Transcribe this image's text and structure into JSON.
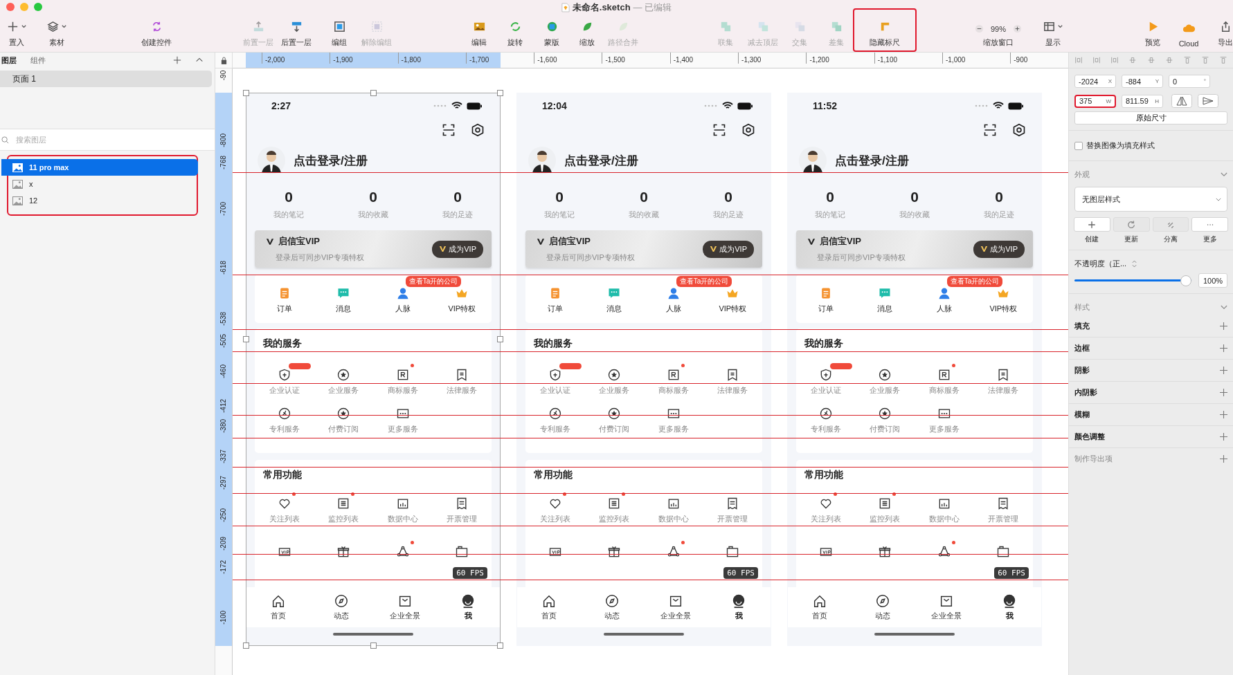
{
  "window": {
    "title": "未命名.sketch",
    "status": "— 已编辑"
  },
  "toolbar": [
    {
      "kind": "button",
      "label": "置入",
      "dropdown": true,
      "disabled": false,
      "highlighted": false
    },
    {
      "kind": "button",
      "label": "素材",
      "dropdown": true,
      "disabled": false,
      "highlighted": false
    },
    {
      "kind": "button",
      "label": "创建控件",
      "dropdown": false,
      "disabled": false,
      "highlighted": false
    },
    {
      "kind": "button",
      "label": "前置一层",
      "dropdown": false,
      "disabled": true,
      "highlighted": false
    },
    {
      "kind": "button",
      "label": "后置一层",
      "dropdown": false,
      "disabled": false,
      "highlighted": false
    },
    {
      "kind": "button",
      "label": "编组",
      "dropdown": false,
      "disabled": false,
      "highlighted": false
    },
    {
      "kind": "button",
      "label": "解除编组",
      "dropdown": false,
      "disabled": true,
      "highlighted": false
    },
    {
      "kind": "button",
      "label": "编辑",
      "dropdown": false,
      "disabled": false,
      "highlighted": false
    },
    {
      "kind": "button",
      "label": "旋转",
      "dropdown": false,
      "disabled": false,
      "highlighted": false
    },
    {
      "kind": "button",
      "label": "蒙版",
      "dropdown": false,
      "disabled": false,
      "highlighted": false
    },
    {
      "kind": "button",
      "label": "缩放",
      "dropdown": false,
      "disabled": false,
      "highlighted": false
    },
    {
      "kind": "button",
      "label": "路径合并",
      "dropdown": false,
      "disabled": true,
      "highlighted": false
    },
    {
      "kind": "button",
      "label": "联集",
      "dropdown": false,
      "disabled": true,
      "highlighted": false
    },
    {
      "kind": "button",
      "label": "减去顶层",
      "dropdown": false,
      "disabled": true,
      "highlighted": false
    },
    {
      "kind": "button",
      "label": "交集",
      "dropdown": false,
      "disabled": true,
      "highlighted": false
    },
    {
      "kind": "button",
      "label": "差集",
      "dropdown": false,
      "disabled": true,
      "highlighted": false
    },
    {
      "kind": "button",
      "label": "隐藏标尺",
      "dropdown": false,
      "disabled": false,
      "highlighted": true
    },
    {
      "kind": "zoom",
      "label": "缩放窗口",
      "value": "99%",
      "disabled": false,
      "highlighted": false
    },
    {
      "kind": "button",
      "label": "显示",
      "dropdown": true,
      "disabled": false,
      "highlighted": false
    },
    {
      "kind": "button",
      "label": "预览",
      "dropdown": false,
      "disabled": false,
      "highlighted": false
    },
    {
      "kind": "button",
      "label": "Cloud",
      "dropdown": false,
      "disabled": false,
      "highlighted": false
    },
    {
      "kind": "button",
      "label": "导出",
      "dropdown": false,
      "disabled": false,
      "highlighted": false
    }
  ],
  "layers_panel": {
    "tabs": [
      {
        "label": "图层",
        "selected": true
      },
      {
        "label": "组件",
        "selected": false
      }
    ],
    "pages": [
      {
        "label": "页面 1",
        "selected": true
      }
    ],
    "search": {
      "placeholder": "搜索图层"
    },
    "layers_highlighted": true,
    "layers": [
      {
        "name": "11 pro max",
        "selected": true
      },
      {
        "name": "x",
        "selected": false
      },
      {
        "name": "12",
        "selected": false
      }
    ]
  },
  "ruler": {
    "x_labels": [
      "-2,000",
      "-1,900",
      "-1,800",
      "-1,700",
      "-1,600",
      "-1,500",
      "-1,400",
      "-1,300",
      "-1,200",
      "-1,100",
      "-1,000",
      "-900"
    ],
    "y_labels": [
      "-90",
      "-800",
      "-768",
      "-700",
      "-618",
      "-538",
      "-505",
      "-460",
      "-412",
      "-380",
      "-337",
      "-297",
      "-250",
      "-209",
      "-172",
      "-100"
    ]
  },
  "phones": [
    {
      "selected": true,
      "time": "2:27",
      "login": "点击登录/注册",
      "stats": [
        {
          "value": "0",
          "label": "我的笔记"
        },
        {
          "value": "0",
          "label": "我的收藏"
        },
        {
          "value": "0",
          "label": "我的足迹"
        }
      ],
      "vip": {
        "title": "启信宝VIP",
        "subtitle": "登录后可同步VIP专项特权",
        "button": "成为VIP"
      },
      "quick": [
        {
          "label": "订单"
        },
        {
          "label": "消息"
        },
        {
          "label": "人脉",
          "badge": "查看Ta开的公司"
        },
        {
          "label": "VIP特权"
        }
      ],
      "services": {
        "title": "我的服务",
        "items": [
          {
            "label": "企业认证",
            "tag": true,
            "dot": false
          },
          {
            "label": "企业服务",
            "tag": false,
            "dot": false
          },
          {
            "label": "商标服务",
            "tag": false,
            "dot": true
          },
          {
            "label": "法律服务",
            "tag": false,
            "dot": false
          },
          {
            "label": "专利服务",
            "tag": false,
            "dot": false
          },
          {
            "label": "付费订阅",
            "tag": false,
            "dot": false
          },
          {
            "label": "更多服务",
            "tag": false,
            "dot": false
          }
        ]
      },
      "common": {
        "title": "常用功能",
        "items": [
          {
            "label": "关注列表",
            "dot": true
          },
          {
            "label": "监控列表",
            "dot": true
          },
          {
            "label": "数据中心",
            "dot": false
          },
          {
            "label": "开票管理",
            "dot": false
          },
          {
            "dot": false
          },
          {
            "dot": false
          },
          {
            "dot": true
          },
          {
            "dot": false
          }
        ]
      },
      "fps": "60 FPS",
      "tabbar": [
        {
          "label": "首页",
          "selected": false
        },
        {
          "label": "动态",
          "selected": false
        },
        {
          "label": "企业全景",
          "selected": false
        },
        {
          "label": "我",
          "selected": true
        }
      ]
    },
    {
      "selected": false,
      "time": "12:04",
      "login": "点击登录/注册",
      "stats": [
        {
          "value": "0",
          "label": "我的笔记"
        },
        {
          "value": "0",
          "label": "我的收藏"
        },
        {
          "value": "0",
          "label": "我的足迹"
        }
      ],
      "vip": {
        "title": "启信宝VIP",
        "subtitle": "登录后可同步VIP专项特权",
        "button": "成为VIP"
      },
      "quick": [
        {
          "label": "订单"
        },
        {
          "label": "消息"
        },
        {
          "label": "人脉",
          "badge": "查看Ta开的公司"
        },
        {
          "label": "VIP特权"
        }
      ],
      "services": {
        "title": "我的服务",
        "items": [
          {
            "label": "企业认证",
            "tag": true,
            "dot": false
          },
          {
            "label": "企业服务",
            "tag": false,
            "dot": false
          },
          {
            "label": "商标服务",
            "tag": false,
            "dot": true
          },
          {
            "label": "法律服务",
            "tag": false,
            "dot": false
          },
          {
            "label": "专利服务",
            "tag": false,
            "dot": false
          },
          {
            "label": "付费订阅",
            "tag": false,
            "dot": false
          },
          {
            "label": "更多服务",
            "tag": false,
            "dot": false
          }
        ]
      },
      "common": {
        "title": "常用功能",
        "items": [
          {
            "label": "关注列表",
            "dot": true
          },
          {
            "label": "监控列表",
            "dot": true
          },
          {
            "label": "数据中心",
            "dot": false
          },
          {
            "label": "开票管理",
            "dot": false
          },
          {
            "dot": false
          },
          {
            "dot": false
          },
          {
            "dot": true
          },
          {
            "dot": false
          }
        ]
      },
      "fps": "60 FPS",
      "tabbar": [
        {
          "label": "首页",
          "selected": false
        },
        {
          "label": "动态",
          "selected": false
        },
        {
          "label": "企业全景",
          "selected": false
        },
        {
          "label": "我",
          "selected": true
        }
      ]
    },
    {
      "selected": false,
      "time": "11:52",
      "login": "点击登录/注册",
      "stats": [
        {
          "value": "0",
          "label": "我的笔记"
        },
        {
          "value": "0",
          "label": "我的收藏"
        },
        {
          "value": "0",
          "label": "我的足迹"
        }
      ],
      "vip": {
        "title": "启信宝VIP",
        "subtitle": "登录后可同步VIP专项特权",
        "button": "成为VIP"
      },
      "quick": [
        {
          "label": "订单"
        },
        {
          "label": "消息"
        },
        {
          "label": "人脉",
          "badge": "查看Ta开的公司"
        },
        {
          "label": "VIP特权"
        }
      ],
      "services": {
        "title": "我的服务",
        "items": [
          {
            "label": "企业认证",
            "tag": true,
            "dot": false
          },
          {
            "label": "企业服务",
            "tag": false,
            "dot": false
          },
          {
            "label": "商标服务",
            "tag": false,
            "dot": true
          },
          {
            "label": "法律服务",
            "tag": false,
            "dot": false
          },
          {
            "label": "专利服务",
            "tag": false,
            "dot": false
          },
          {
            "label": "付费订阅",
            "tag": false,
            "dot": false
          },
          {
            "label": "更多服务",
            "tag": false,
            "dot": false
          }
        ]
      },
      "common": {
        "title": "常用功能",
        "items": [
          {
            "label": "关注列表",
            "dot": true
          },
          {
            "label": "监控列表",
            "dot": true
          },
          {
            "label": "数据中心",
            "dot": false
          },
          {
            "label": "开票管理",
            "dot": false
          },
          {
            "dot": false
          },
          {
            "dot": false
          },
          {
            "dot": true
          },
          {
            "dot": false
          }
        ]
      },
      "fps": "60 FPS",
      "tabbar": [
        {
          "label": "首页",
          "selected": false
        },
        {
          "label": "动态",
          "selected": false
        },
        {
          "label": "企业全景",
          "selected": false
        },
        {
          "label": "我",
          "selected": true
        }
      ]
    }
  ],
  "inspector": {
    "fields": [
      {
        "value": "-2024",
        "unit": "X",
        "highlighted": false
      },
      {
        "value": "-884",
        "unit": "Y",
        "highlighted": false
      },
      {
        "value": "0",
        "unit": "°",
        "highlighted": false
      },
      {
        "value": "375",
        "unit": "W",
        "highlighted": true
      },
      {
        "value": "811.59",
        "unit": "H",
        "highlighted": false
      }
    ],
    "original_size": "原始尺寸",
    "fill_checkbox": {
      "label": "替换图像为填充样式",
      "checked": false
    },
    "appearance": {
      "title": "外观",
      "style": "无图层样式",
      "actions": [
        {
          "label": "创建",
          "disabled": false
        },
        {
          "label": "更新",
          "disabled": true
        },
        {
          "label": "分离",
          "disabled": true
        },
        {
          "label": "更多",
          "disabled": false
        }
      ]
    },
    "opacity": {
      "label": "不透明度（正...",
      "level": 1.0,
      "value": "100%"
    },
    "style_title": "样式",
    "rows": [
      {
        "label": "填充",
        "muted": false
      },
      {
        "label": "边框",
        "muted": false
      },
      {
        "label": "阴影",
        "muted": false
      },
      {
        "label": "内阴影",
        "muted": false
      },
      {
        "label": "模糊",
        "muted": false
      },
      {
        "label": "颜色调整",
        "muted": false
      },
      {
        "label": "制作导出项",
        "muted": true
      }
    ]
  }
}
